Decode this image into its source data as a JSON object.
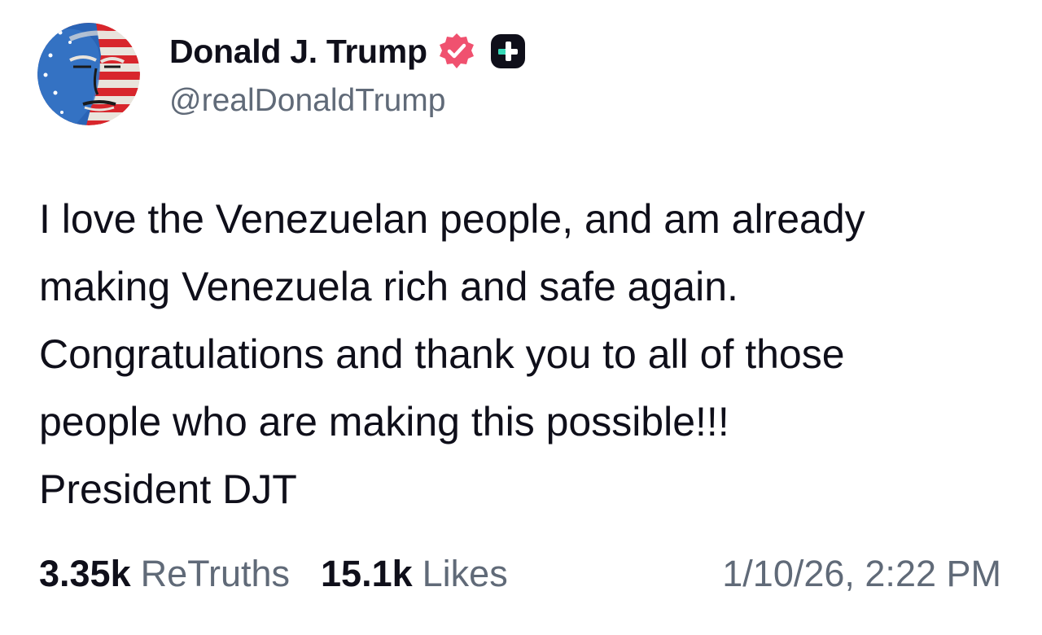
{
  "post": {
    "author": {
      "display_name": "Donald J. Trump",
      "handle": "@realDonaldTrump",
      "avatar_icon": "avatar-flag-portrait",
      "verified_icon": "verified-badge-icon",
      "verified_color": "#f0516f",
      "plus_icon": "plus-badge-icon",
      "plus_badge_color": "#0f0f1a",
      "plus_accent_color": "#35d8b6"
    },
    "text": "I love the Venezuelan people, and am already\nmaking Venezuela rich and safe again.\nCongratulations and thank you to all of those\npeople who are making this possible!!!\nPresident DJT",
    "stats": {
      "retruths_count": "3.35k",
      "retruths_label": "ReTruths",
      "likes_count": "15.1k",
      "likes_label": "Likes"
    },
    "timestamp": "1/10/26, 2:22 PM"
  }
}
